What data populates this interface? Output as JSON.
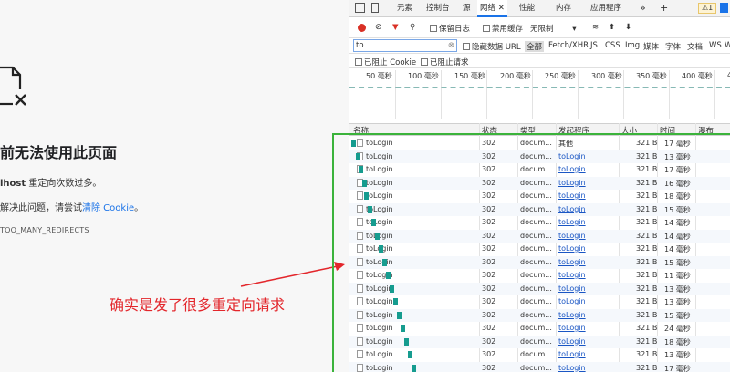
{
  "error_page": {
    "title": "前无法使用此页面",
    "msg_host": "lhost",
    "msg_rest": " 重定向次数过多。",
    "try_prefix": "解决此问题，请尝试",
    "try_link": "清除 Cookie",
    "try_suffix": "。",
    "code": "TOO_MANY_REDIRECTS"
  },
  "annotation": {
    "text": "确实是发了很多重定向请求",
    "color": "#e3262b"
  },
  "devtools": {
    "tabs": [
      "元素",
      "控制台",
      "源",
      "网络",
      "性能",
      "内存",
      "应用程序"
    ],
    "more_glyph": "»",
    "add_glyph": "+",
    "warning_count": "1",
    "toolbar": {
      "preserve_log": "保留日志",
      "disable_cache": "禁用缓存",
      "throttle": "无限制"
    },
    "filter": {
      "value": "to",
      "hide_data_urls": "隐藏数据 URL",
      "types": [
        "全部",
        "Fetch/XHR",
        "JS",
        "CSS",
        "Img",
        "媒体",
        "字体",
        "文档",
        "WS",
        "W"
      ]
    },
    "blocked": {
      "blocked_cookies": "已阻止 Cookie",
      "blocked_requests": "已阻止请求"
    },
    "timeline_ticks": [
      "50 毫秒",
      "100 毫秒",
      "150 毫秒",
      "200 毫秒",
      "250 毫秒",
      "300 毫秒",
      "350 毫秒",
      "400 毫秒",
      "4"
    ],
    "columns": [
      "名称",
      "状态",
      "类型",
      "发起程序",
      "大小",
      "时间",
      "瀑布"
    ],
    "rows": [
      {
        "name": "toLogin",
        "status": "302",
        "type": "docum...",
        "initiator": "其他",
        "size": "321 B",
        "time": "17 毫秒"
      },
      {
        "name": "toLogin",
        "status": "302",
        "type": "docum...",
        "initiator": "toLogin",
        "size": "321 B",
        "time": "13 毫秒"
      },
      {
        "name": "toLogin",
        "status": "302",
        "type": "docum...",
        "initiator": "toLogin",
        "size": "321 B",
        "time": "17 毫秒"
      },
      {
        "name": "toLogin",
        "status": "302",
        "type": "docum...",
        "initiator": "toLogin",
        "size": "321 B",
        "time": "16 毫秒"
      },
      {
        "name": "toLogin",
        "status": "302",
        "type": "docum...",
        "initiator": "toLogin",
        "size": "321 B",
        "time": "18 毫秒"
      },
      {
        "name": "toLogin",
        "status": "302",
        "type": "docum...",
        "initiator": "toLogin",
        "size": "321 B",
        "time": "15 毫秒"
      },
      {
        "name": "toLogin",
        "status": "302",
        "type": "docum...",
        "initiator": "toLogin",
        "size": "321 B",
        "time": "14 毫秒"
      },
      {
        "name": "toLogin",
        "status": "302",
        "type": "docum...",
        "initiator": "toLogin",
        "size": "321 B",
        "time": "14 毫秒"
      },
      {
        "name": "toLogin",
        "status": "302",
        "type": "docum...",
        "initiator": "toLogin",
        "size": "321 B",
        "time": "14 毫秒"
      },
      {
        "name": "toLogin",
        "status": "302",
        "type": "docum...",
        "initiator": "toLogin",
        "size": "321 B",
        "time": "15 毫秒"
      },
      {
        "name": "toLogin",
        "status": "302",
        "type": "docum...",
        "initiator": "toLogin",
        "size": "321 B",
        "time": "11 毫秒"
      },
      {
        "name": "toLogin",
        "status": "302",
        "type": "docum...",
        "initiator": "toLogin",
        "size": "321 B",
        "time": "13 毫秒"
      },
      {
        "name": "toLogin",
        "status": "302",
        "type": "docum...",
        "initiator": "toLogin",
        "size": "321 B",
        "time": "13 毫秒"
      },
      {
        "name": "toLogin",
        "status": "302",
        "type": "docum...",
        "initiator": "toLogin",
        "size": "321 B",
        "time": "15 毫秒"
      },
      {
        "name": "toLogin",
        "status": "302",
        "type": "docum...",
        "initiator": "toLogin",
        "size": "321 B",
        "time": "24 毫秒"
      },
      {
        "name": "toLogin",
        "status": "302",
        "type": "docum...",
        "initiator": "toLogin",
        "size": "321 B",
        "time": "18 毫秒"
      },
      {
        "name": "toLogin",
        "status": "302",
        "type": "docum...",
        "initiator": "toLogin",
        "size": "321 B",
        "time": "13 毫秒"
      },
      {
        "name": "toLogin",
        "status": "302",
        "type": "docum...",
        "initiator": "toLogin",
        "size": "321 B",
        "time": "17 毫秒"
      }
    ],
    "colors": {
      "accent": "#1a73e8",
      "waterfall": "#169c8f",
      "highlight_box": "#3bb33b"
    }
  }
}
